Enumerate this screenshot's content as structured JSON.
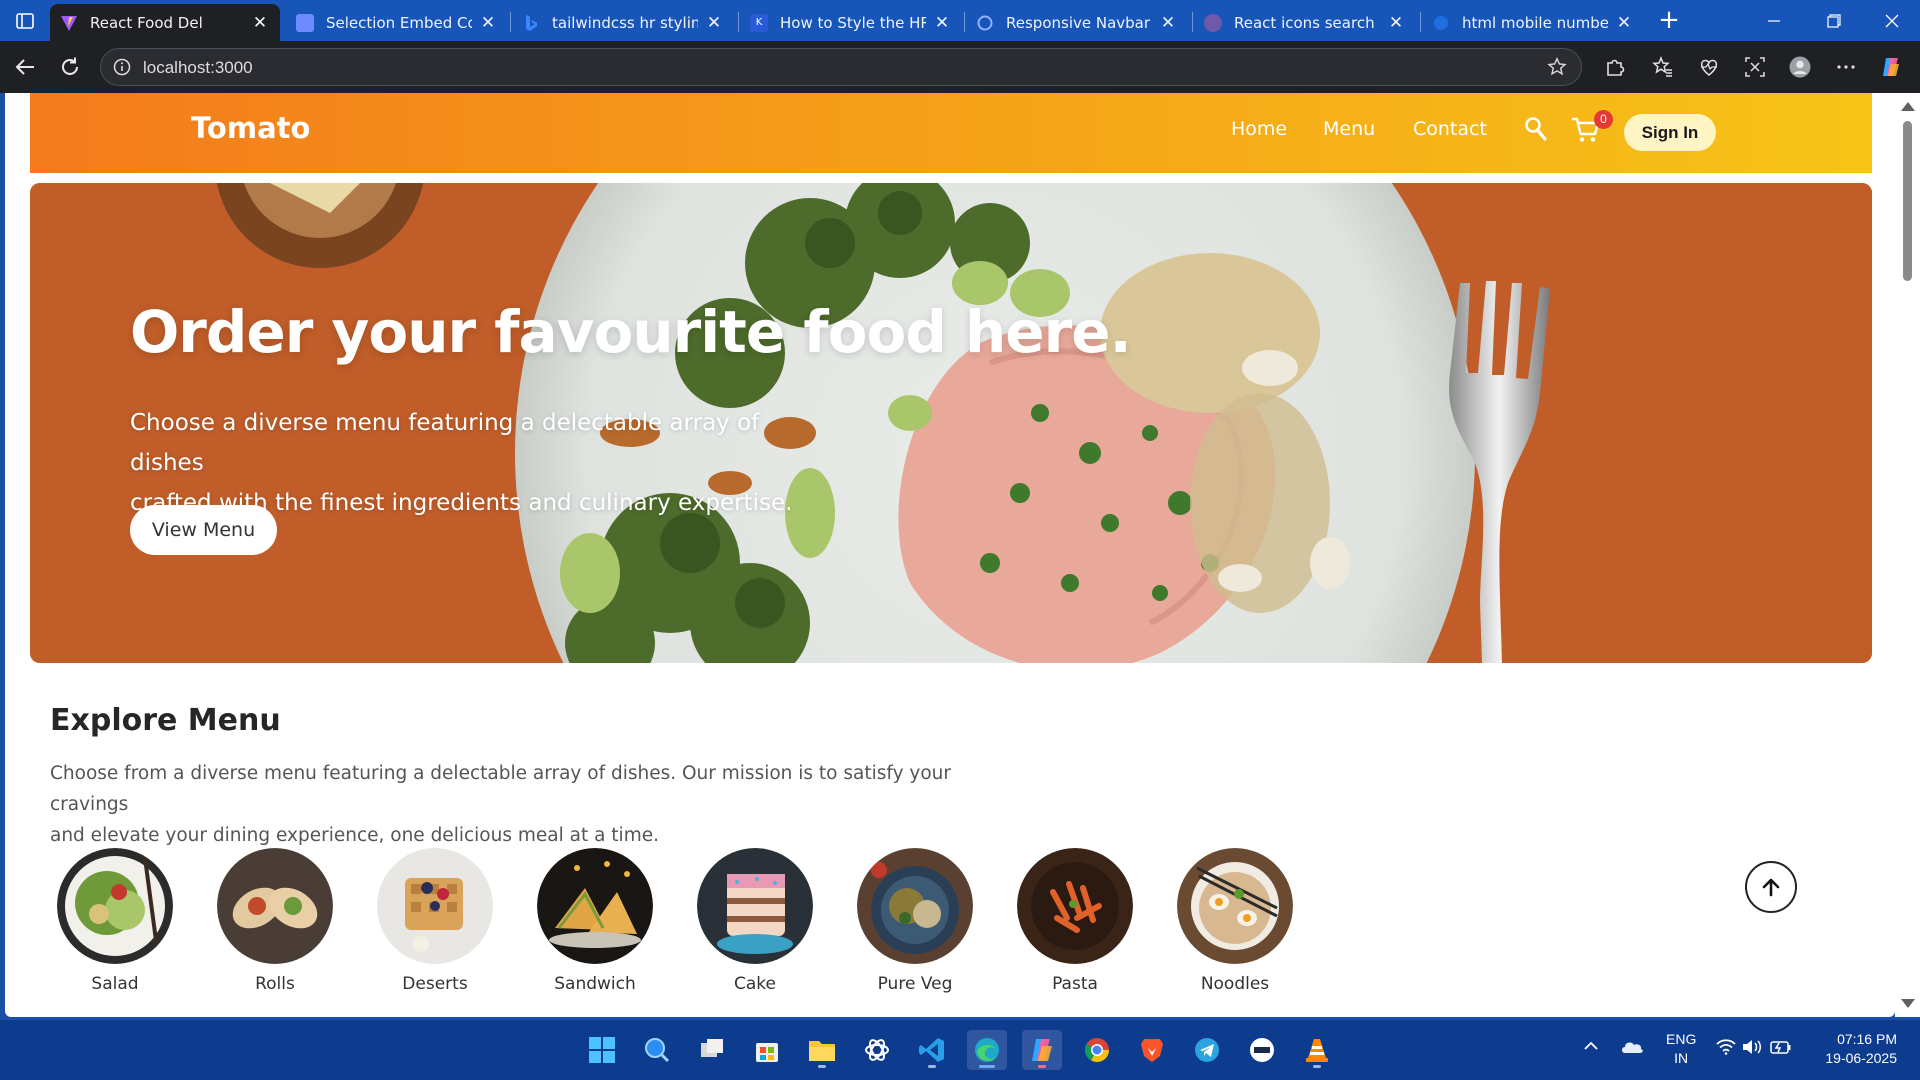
{
  "browser": {
    "tabs": [
      {
        "title": "React Food Del",
        "active": true,
        "favicon_color": "#9b59ff"
      },
      {
        "title": "Selection Embed Code",
        "active": false,
        "favicon_color": "#6b8cff"
      },
      {
        "title": "tailwindcss hr styling -",
        "active": false,
        "favicon_color": "#3a86ff"
      },
      {
        "title": "How to Style the HR El",
        "active": false,
        "favicon_color": "#2a5bd7"
      },
      {
        "title": "Responsive Navbar Co",
        "active": false,
        "favicon_color": "#8fb3ff"
      },
      {
        "title": "React icons search resu",
        "active": false,
        "favicon_color": "#6e5aa8"
      },
      {
        "title": "html mobile number in",
        "active": false,
        "favicon_color": "#1f6fe0"
      }
    ],
    "url": "localhost:3000"
  },
  "site": {
    "logo": "Tomato",
    "nav": {
      "home": "Home",
      "menu": "Menu",
      "contact": "Contact"
    },
    "cart_count": "0",
    "signin": "Sign In"
  },
  "hero": {
    "title": "Order your favourite food here.",
    "subtitle_line1": "Choose a diverse menu featuring a delectable array of dishes",
    "subtitle_line2": "crafted with the finest ingredients and culinary expertise.",
    "button": "View Menu"
  },
  "explore": {
    "title": "Explore Menu",
    "text_line1": "Choose from a diverse menu featuring a delectable array of dishes. Our mission is to satisfy your cravings",
    "text_line2": "and elevate your dining experience, one delicious meal at a time.",
    "items": [
      {
        "label": "Salad"
      },
      {
        "label": "Rolls"
      },
      {
        "label": "Deserts"
      },
      {
        "label": "Sandwich"
      },
      {
        "label": "Cake"
      },
      {
        "label": "Pure Veg"
      },
      {
        "label": "Pasta"
      },
      {
        "label": "Noodles"
      }
    ]
  },
  "taskbar": {
    "language": "ENG",
    "region": "IN",
    "time": "07:16 PM",
    "date": "19-06-2025"
  },
  "colors": {
    "nav_gradient_start": "#f47a1c",
    "nav_gradient_end": "#f6c417",
    "hero_bg": "#c65f2b",
    "taskbar": "#0d3b8e"
  }
}
